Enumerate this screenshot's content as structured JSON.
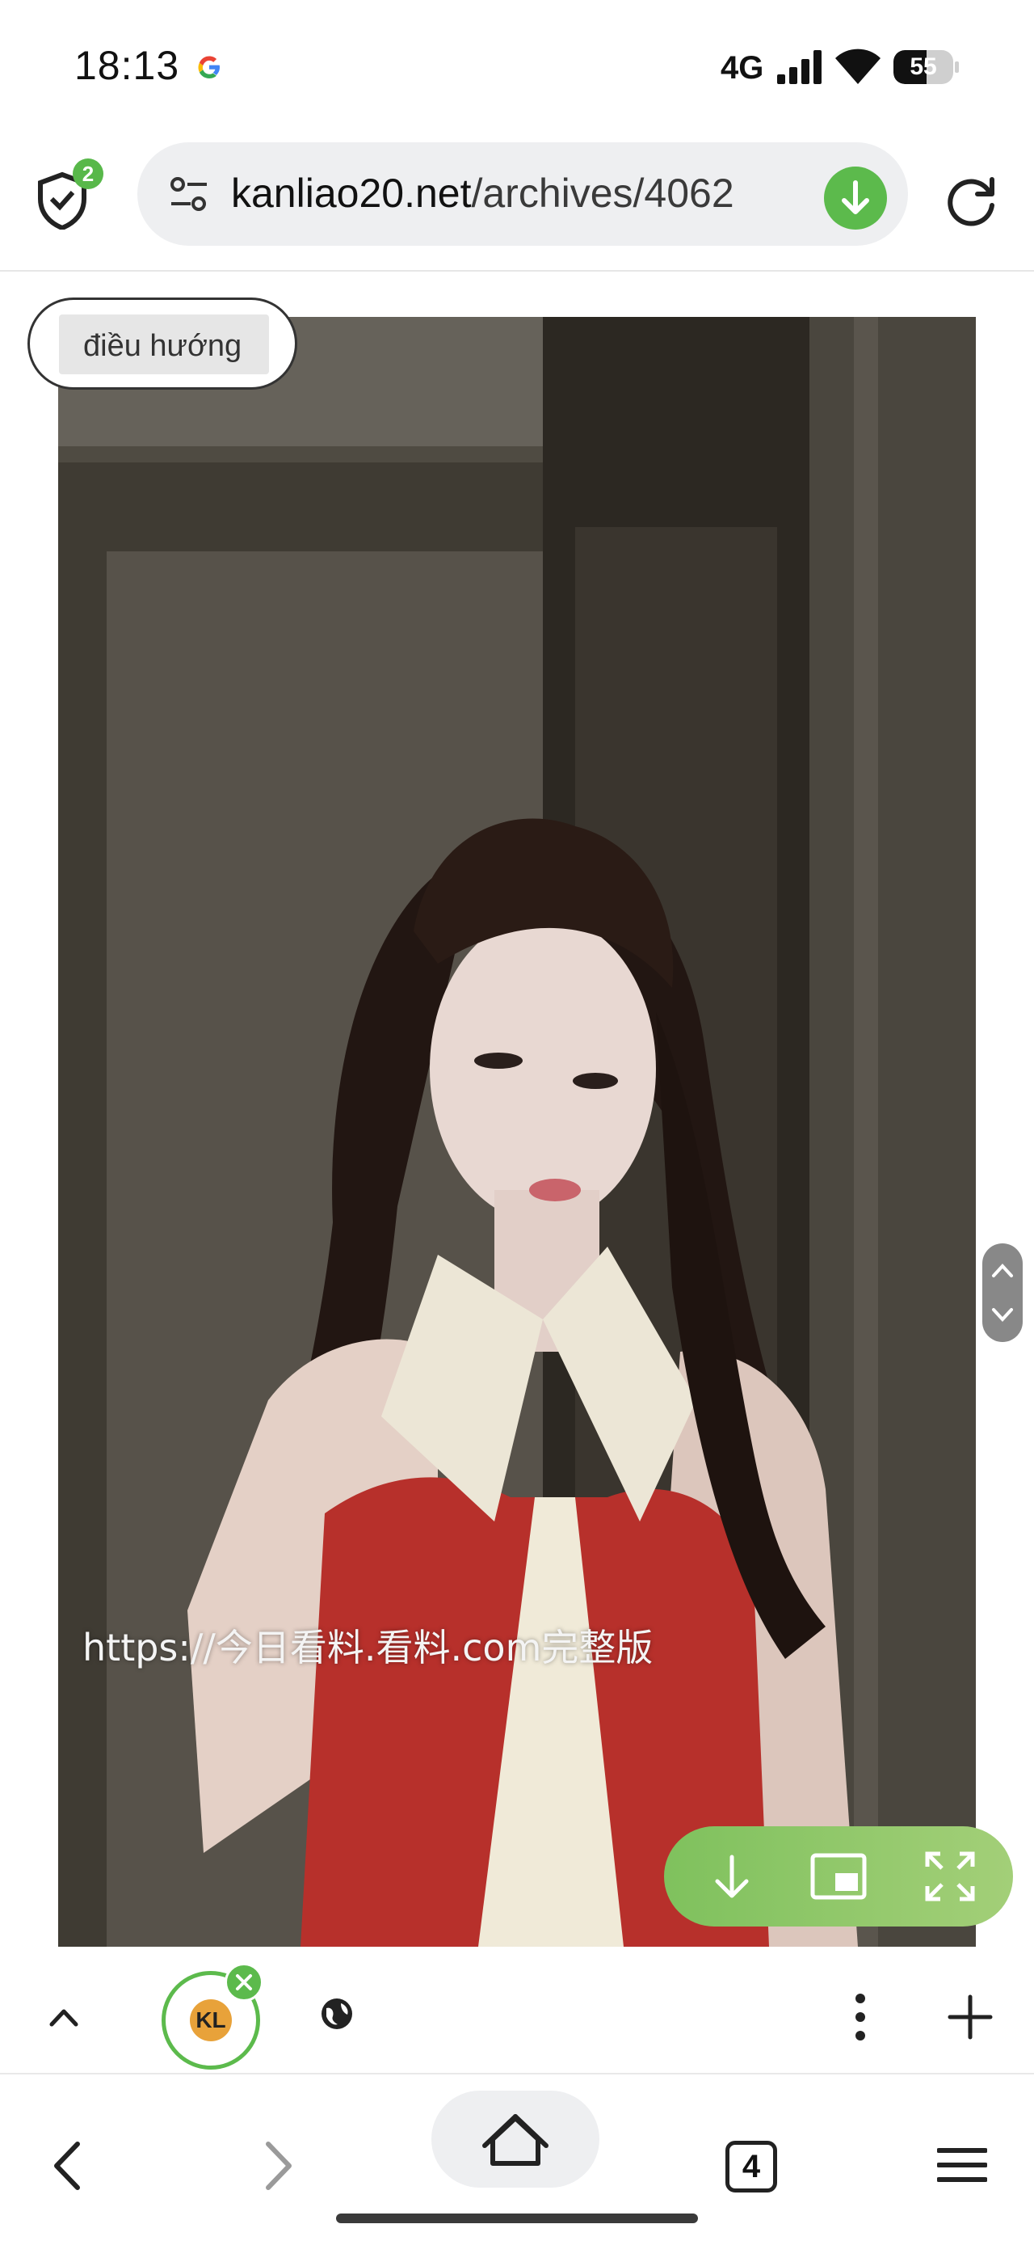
{
  "status_bar": {
    "time": "18:13",
    "network": "4G",
    "battery": "55",
    "battery_level": 0.55,
    "google_icon": "google-g-icon",
    "signal_icon": "cell-signal-icon",
    "wifi_icon": "wifi-icon"
  },
  "toolbar": {
    "url_domain": "kanliao20.net",
    "url_path": "/archives/4062",
    "shield_badge": "2",
    "shield_icon": "shield-icon",
    "site_settings_icon": "tune-icon",
    "download_icon": "download-icon",
    "reload_icon": "reload-icon",
    "accent_color": "#5cba4c"
  },
  "content": {
    "nav_chip_label": "điều hướng",
    "video_watermark": "https://今日看料.看料.com完整版",
    "video_controls": [
      "download-icon",
      "picture-in-picture-icon",
      "fullscreen-icon"
    ],
    "scroll_controls": [
      "chevron-up-icon",
      "chevron-down-icon"
    ]
  },
  "tab_strip": {
    "tab_favicon_text": "KL",
    "icons": [
      "chevron-up-icon",
      "close-icon",
      "globe-icon",
      "more-vert-icon",
      "plus-icon"
    ]
  },
  "bottom_nav": {
    "tab_count": "4",
    "icons": [
      "back-icon",
      "forward-icon",
      "home-icon",
      "tabs-icon",
      "menu-icon"
    ]
  }
}
